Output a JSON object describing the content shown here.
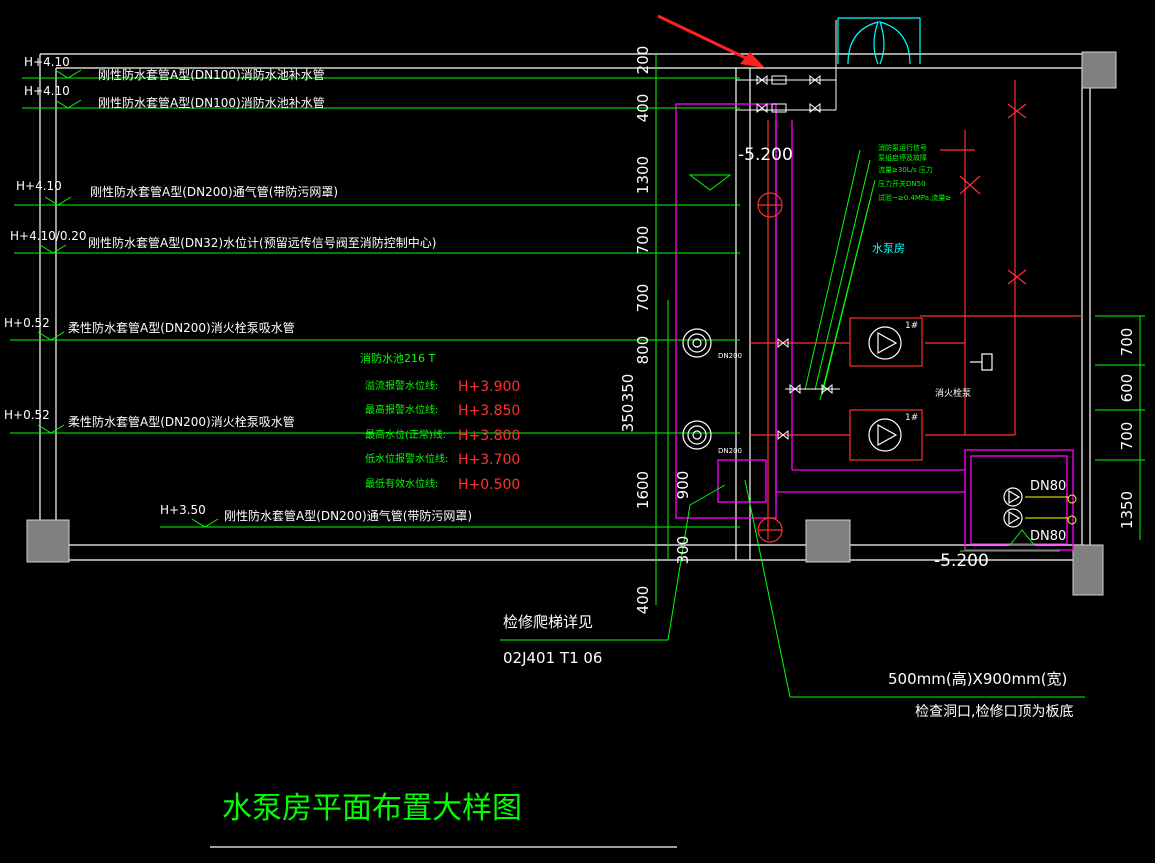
{
  "title": "水泵房平面布置大样图",
  "pipe_labels": [
    {
      "level": "H+4.10",
      "text": "刚性防水套管A型(DN100)消防水池补水管"
    },
    {
      "level": "H+4.10",
      "text": "刚性防水套管A型(DN100)消防水池补水管"
    },
    {
      "level": "H+4.10",
      "text": "刚性防水套管A型(DN200)通气管(带防污网罩)"
    },
    {
      "level": "H+4.10/0.20",
      "text": "刚性防水套管A型(DN32)水位计(预留远传信号阀至消防控制中心)"
    },
    {
      "level": "H+0.52",
      "text": "柔性防水套管A型(DN200)消火栓泵吸水管"
    },
    {
      "level": "H+0.52",
      "text": "柔性防水套管A型(DN200)消火栓泵吸水管"
    },
    {
      "level": "H+3.50",
      "text": "刚性防水套管A型(DN200)通气管(带防污网罩)"
    }
  ],
  "tank_title": "消防水池216 T",
  "water_levels": [
    {
      "label": "溢流报警水位线:",
      "value": "H+3.900"
    },
    {
      "label": "最高报警水位线:",
      "value": "H+3.850"
    },
    {
      "label": "最高水位(正常)线:",
      "value": "H+3.800"
    },
    {
      "label": "低水位报警水位线:",
      "value": "H+3.700"
    },
    {
      "label": "最低有效水位线:",
      "value": "H+0.500"
    }
  ],
  "dims_left": [
    "200",
    "400",
    "1300",
    "700",
    "700",
    "800",
    "350",
    "350",
    "1600",
    "900",
    "300",
    "400"
  ],
  "dims_right": [
    "700",
    "600",
    "700",
    "1350"
  ],
  "elevation_top": "-5.200",
  "elevation_bottom": "-5.200",
  "pump_room_label": "水泵房",
  "pump_tags": [
    "1#",
    "1#"
  ],
  "hydrant_label": "消火栓泵",
  "dn_labels": [
    "DN200",
    "DN200",
    "DN80",
    "DN80"
  ],
  "small_notes": [
    "消防泵运行信号",
    "泵组启停及故障",
    "流量≥30L/s 压力",
    "压力开关DN50",
    "试验~≥0.4MPa,流量≥"
  ],
  "note_ladder": [
    "检修爬梯详见",
    "02J401 T1 06"
  ],
  "note_opening": [
    "500mm(高)X900mm(宽)",
    "检查洞口,检修口顶为板底"
  ],
  "colors": {
    "bg": "#000000",
    "wall": "#ffffff",
    "pipe": "#00ff00",
    "tank": "#ff00ff",
    "red": "#ff3030",
    "cyan": "#00ffff",
    "yellow": "#ffff00",
    "gray": "#808080"
  }
}
